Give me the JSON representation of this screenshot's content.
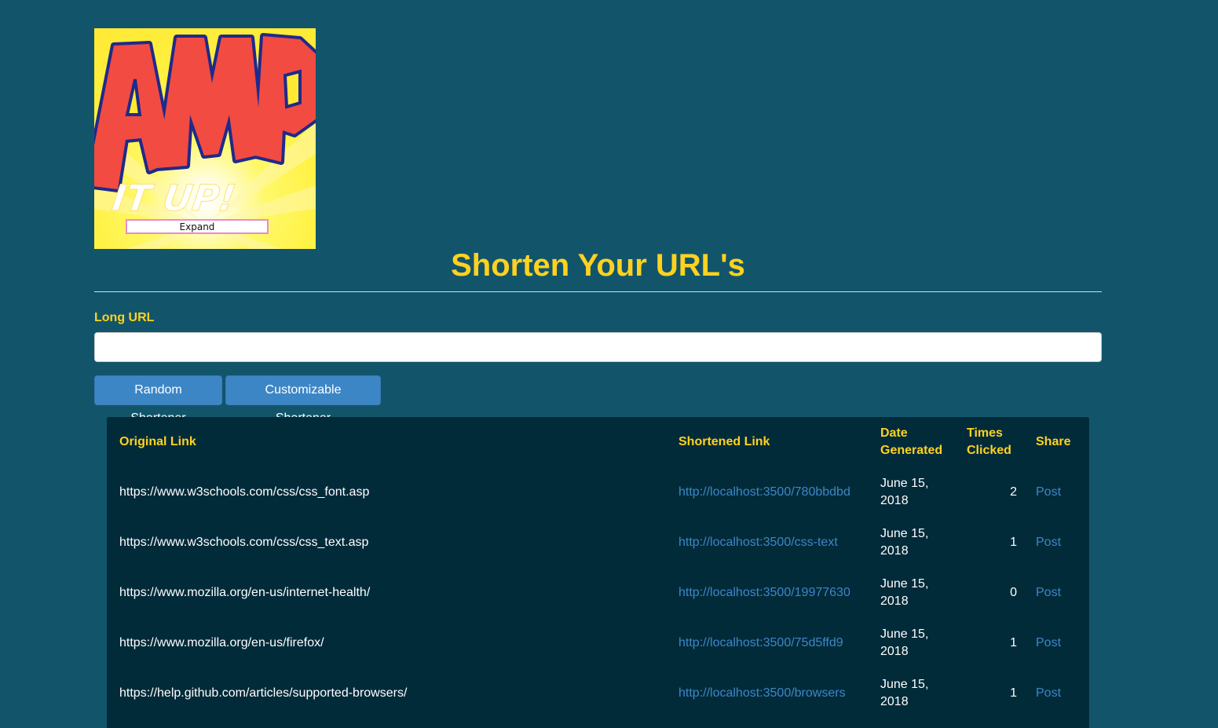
{
  "logo": {
    "text_main": "AMP",
    "text_sub": "IT UP!",
    "expand_label": "Expand"
  },
  "page_title": "Shorten Your URL's",
  "form": {
    "long_url_label": "Long URL",
    "long_url_value": "",
    "random_button": "Random Shortener",
    "custom_button": "Customizable Shortener"
  },
  "table": {
    "headers": {
      "original": "Original Link",
      "shortened": "Shortened Link",
      "date": "Date Generated",
      "times": "Times Clicked",
      "share": "Share"
    },
    "rows": [
      {
        "original": "https://www.w3schools.com/css/css_font.asp",
        "shortened": "http://localhost:3500/780bbdbd",
        "date": "June 15, 2018",
        "times": "2",
        "share": "Post"
      },
      {
        "original": "https://www.w3schools.com/css/css_text.asp",
        "shortened": "http://localhost:3500/css-text",
        "date": "June 15, 2018",
        "times": "1",
        "share": "Post"
      },
      {
        "original": "https://www.mozilla.org/en-us/internet-health/",
        "shortened": "http://localhost:3500/19977630",
        "date": "June 15, 2018",
        "times": "0",
        "share": "Post"
      },
      {
        "original": "https://www.mozilla.org/en-us/firefox/",
        "shortened": "http://localhost:3500/75d5ffd9",
        "date": "June 15, 2018",
        "times": "1",
        "share": "Post"
      },
      {
        "original": "https://help.github.com/articles/supported-browsers/",
        "shortened": "http://localhost:3500/browsers",
        "date": "June 15, 2018",
        "times": "1",
        "share": "Post"
      }
    ]
  },
  "colors": {
    "background": "#12556b",
    "accent_yellow": "#ffd21f",
    "button_blue": "#3d86c6",
    "table_bg": "#022b3a",
    "link_blue": "#3d86c6"
  }
}
